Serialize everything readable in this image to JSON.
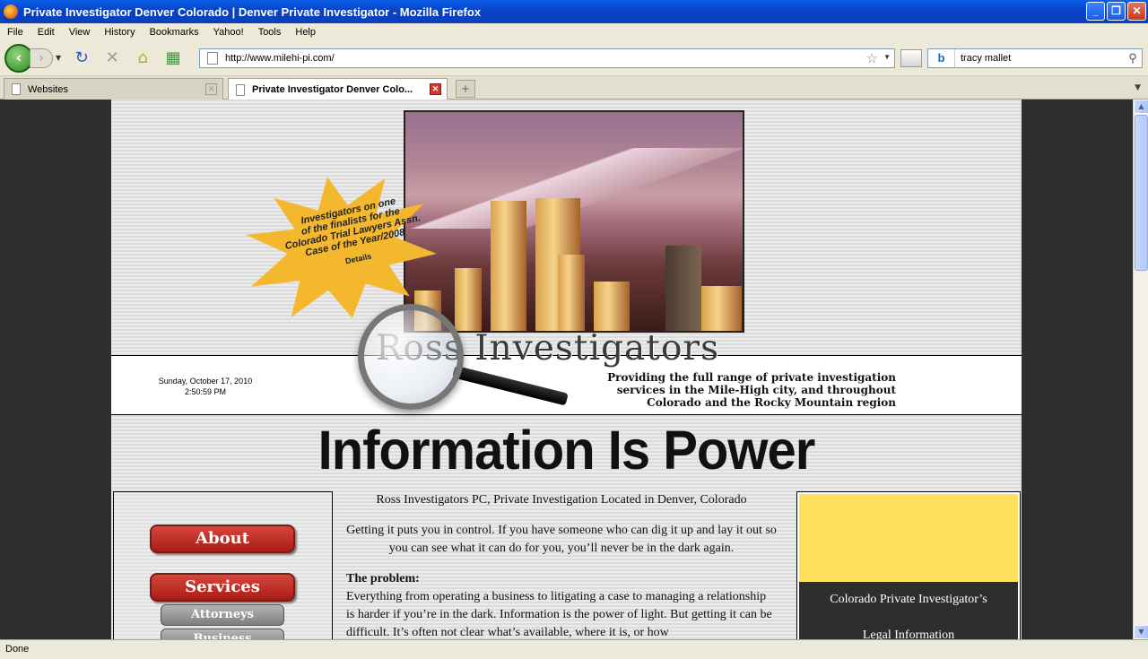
{
  "window": {
    "title": "Private Investigator Denver Colorado | Denver Private Investigator - Mozilla Firefox"
  },
  "menu": [
    "File",
    "Edit",
    "View",
    "History",
    "Bookmarks",
    "Yahoo!",
    "Tools",
    "Help"
  ],
  "toolbar": {
    "url": "http://www.milehi-pi.com/",
    "search_value": "tracy mallet"
  },
  "tabs": [
    {
      "label": "Websites"
    },
    {
      "label": "Private Investigator Denver Colo..."
    }
  ],
  "status": {
    "text": "Done"
  },
  "page": {
    "starburst": {
      "lines": [
        "Investigators on one",
        "of the finalists for the",
        "Colorado Trial Lawyers Assn.",
        "Case of the Year/2008"
      ],
      "details": "Details"
    },
    "date": "Sunday, October 17, 2010",
    "time": "2:50:59 PM",
    "brand": "Ross Investigators",
    "tagline": [
      "Providing the full range of private investigation",
      "services in the Mile-High city, and throughout",
      "Colorado and the Rocky Mountain region"
    ],
    "headline": "Information Is Power",
    "nav": {
      "about": "About",
      "services": "Services",
      "attorneys": "Attorneys",
      "next": "Business"
    },
    "main": {
      "heading": "Ross Investigators PC, Private Investigation Located in Denver, Colorado",
      "intro": "Getting it puts you in control. If you have someone who can dig it up and lay it out so you can see what it can do for you, you’ll never be in the dark again.",
      "problem_label": "The problem:",
      "problem_text": "Everything from operating a business to litigating a case to managing a relationship is harder if you’re in the dark. Information is the power of light. But getting it can be difficult. It’s often not clear what’s available, where it is, or how"
    },
    "side": {
      "line1": "Colorado Private Investigator’s",
      "line2": "Legal Information"
    }
  }
}
